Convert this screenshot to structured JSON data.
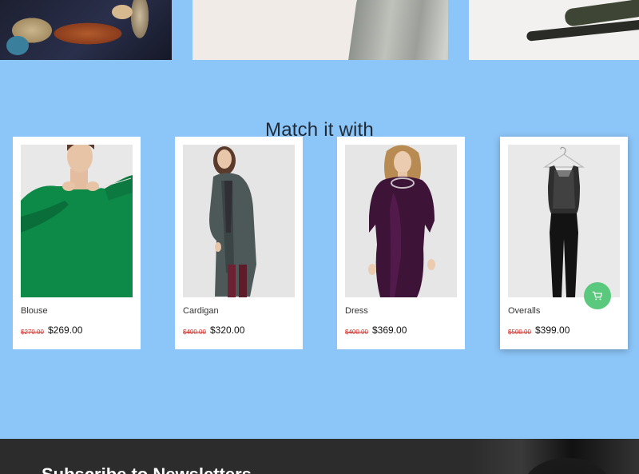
{
  "section": {
    "title": "Match it with"
  },
  "products": [
    {
      "name": "Blouse",
      "old_price": "$270.00",
      "price": "$269.00"
    },
    {
      "name": "Cardigan",
      "old_price": "$400.00",
      "price": "$320.00"
    },
    {
      "name": "Dress",
      "old_price": "$400.00",
      "price": "$369.00"
    },
    {
      "name": "Overalls",
      "old_price": "$500.00",
      "price": "$399.00"
    }
  ],
  "cart_button": {
    "icon": "cart-icon"
  },
  "newsletter": {
    "title": "Subscribe to Newsletters"
  },
  "colors": {
    "background": "#8cc5f8",
    "accent_green": "#5bc97d",
    "old_price_red": "#d3352e",
    "footer_dark": "#2c2c2c"
  }
}
